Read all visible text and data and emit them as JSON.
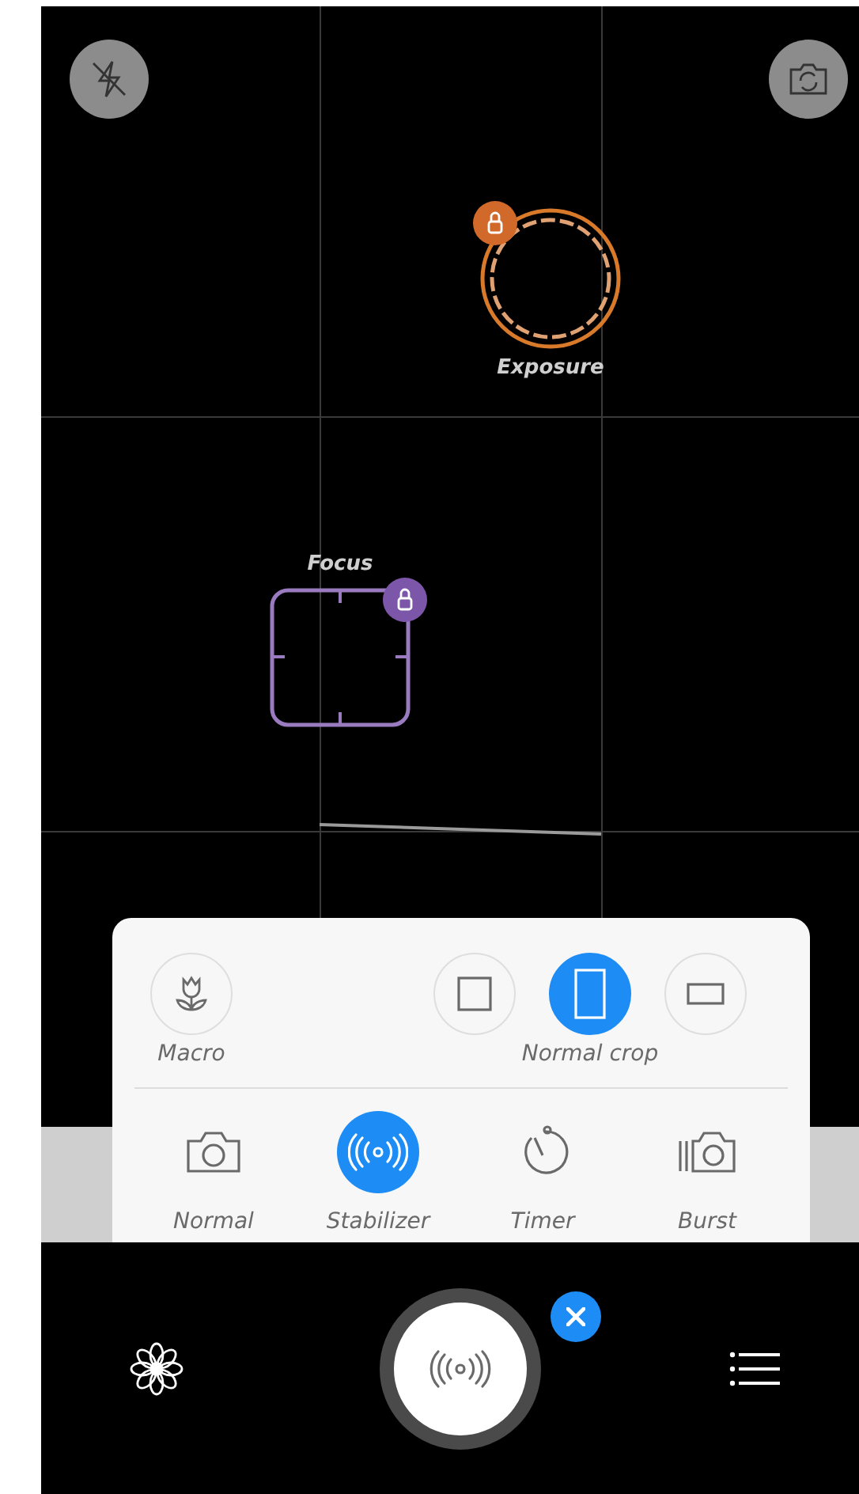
{
  "exposure": {
    "label": "Exposure",
    "locked": true
  },
  "focus": {
    "label": "Focus",
    "locked": true
  },
  "panel": {
    "macro": {
      "label": "Macro",
      "selected": false
    },
    "crop_options": [
      {
        "kind": "square",
        "selected": false
      },
      {
        "kind": "portrait",
        "selected": true
      },
      {
        "kind": "wide",
        "selected": false
      }
    ],
    "crop_label": "Normal crop",
    "modes": [
      {
        "kind": "normal",
        "label": "Normal",
        "selected": false
      },
      {
        "kind": "stabilizer",
        "label": "Stabilizer",
        "selected": true
      },
      {
        "kind": "timer",
        "label": "Timer",
        "selected": false
      },
      {
        "kind": "burst",
        "label": "Burst",
        "selected": false
      }
    ]
  },
  "shutter": {
    "kind": "stabilizer"
  }
}
